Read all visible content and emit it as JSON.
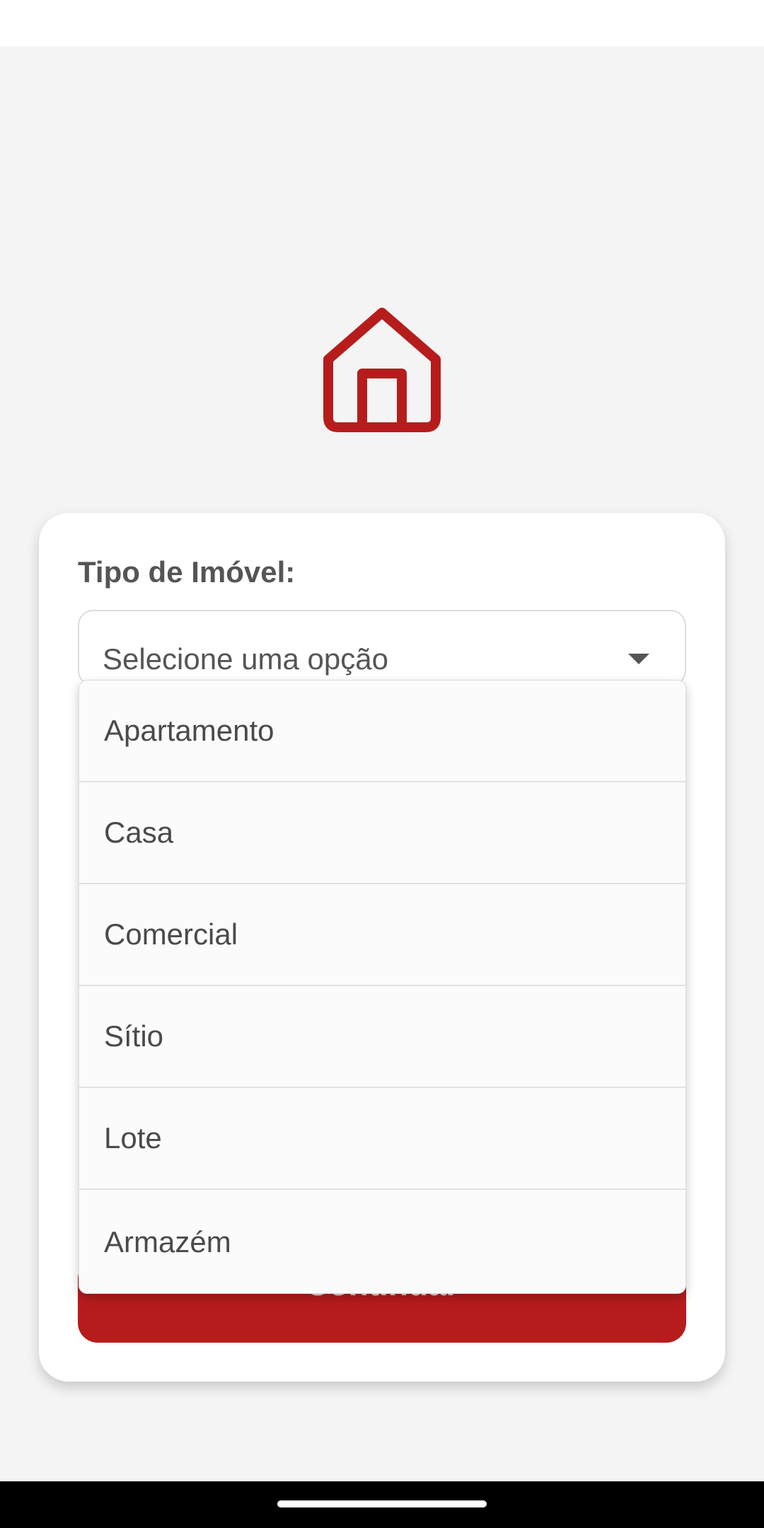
{
  "form": {
    "property_type_label": "Tipo de Imóvel:",
    "select_placeholder": "Selecione uma opção",
    "continue_label": "Continuar"
  },
  "dropdown": {
    "options": [
      "Apartamento",
      "Casa",
      "Comercial",
      "Sítio",
      "Lote",
      "Armazém"
    ]
  },
  "logo": {
    "icon": "house-icon"
  },
  "colors": {
    "brand_red": "#b71c1c",
    "background": "#f4f4f4",
    "card": "#ffffff",
    "text": "#555555"
  }
}
